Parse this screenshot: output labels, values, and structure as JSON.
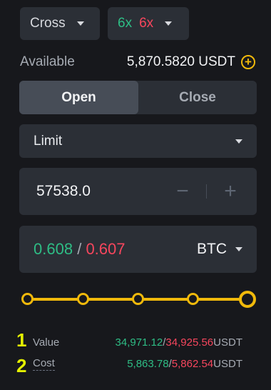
{
  "margin_mode": {
    "label": "Cross"
  },
  "leverage": {
    "long": "6x",
    "short": "6x"
  },
  "available": {
    "label": "Available",
    "value": "5,870.5820 USDT"
  },
  "tabs": {
    "open": "Open",
    "close": "Close"
  },
  "order_type": {
    "selected": "Limit"
  },
  "price": {
    "value": "57538.0",
    "decrement": "−",
    "increment": "+"
  },
  "quantity": {
    "buy": "0.608",
    "separator": "/",
    "sell": "0.607",
    "unit": "BTC"
  },
  "slider": {
    "level_percent": 100,
    "stops": 5
  },
  "summary": {
    "value": {
      "marker": "1",
      "label": "Value",
      "buy": "34,971.12",
      "sell": "34,925.56",
      "slash": "/",
      "unit": "USDT"
    },
    "cost": {
      "marker": "2",
      "label": "Cost",
      "buy": "5,863.78",
      "sell": "5,862.54",
      "slash": "/",
      "unit": "USDT"
    }
  },
  "colors": {
    "accent": "#f0b90b",
    "buy": "#2ebd85",
    "sell": "#f6465d",
    "marker": "#e4f000"
  }
}
